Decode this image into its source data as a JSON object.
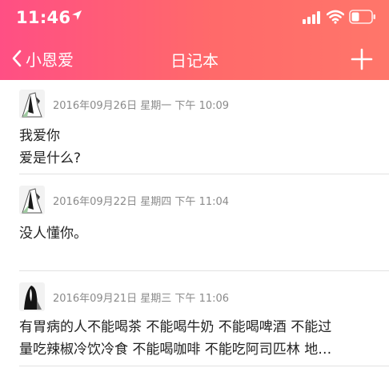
{
  "status_bar": {
    "time": "11:46"
  },
  "nav": {
    "back_label": "小恩爱",
    "title": "日记本"
  },
  "entries": [
    {
      "date": "2016年09月26日 星期一 下午 10:09",
      "lines": [
        "我爱你",
        "爱是什么?"
      ]
    },
    {
      "date": "2016年09月22日 星期四 下午 11:04",
      "lines": [
        "没人懂你。"
      ]
    },
    {
      "date": "2016年09月21日 星期三 下午 11:06",
      "lines": [
        "有胃病的人不能喝茶 不能喝牛奶 不能喝啤酒 不能过",
        "量吃辣椒冷饮冷食 不能喝咖啡 不能吃阿司匹林 地…"
      ]
    }
  ],
  "colors": {
    "header_gradient_start": "#ff4f84",
    "header_gradient_end": "#ff766a",
    "date_text": "#8a8a8a",
    "divider": "#e2e2e2"
  },
  "icons": [
    "location-arrow-icon",
    "cellular-signal-icon",
    "wifi-icon",
    "battery-icon",
    "chevron-left-icon",
    "plus-icon",
    "avatar"
  ]
}
